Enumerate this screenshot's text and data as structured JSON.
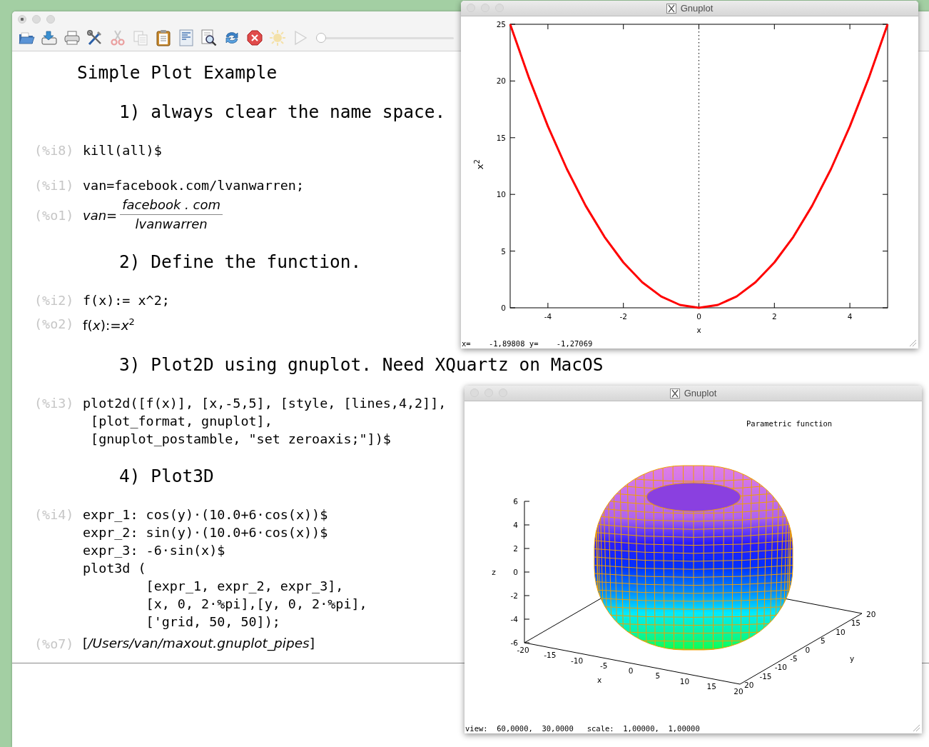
{
  "main_window": {
    "toolbar": {
      "buttons": [
        {
          "disabled": false
        },
        {
          "disabled": false
        },
        {
          "disabled": false
        },
        {
          "disabled": false
        },
        {
          "disabled": true
        },
        {
          "disabled": true
        },
        {
          "disabled": false
        },
        {
          "disabled": false
        },
        {
          "disabled": false
        },
        {
          "disabled": false
        },
        {
          "disabled": false
        },
        {
          "disabled": true
        },
        {
          "disabled": true
        }
      ],
      "slider": {
        "level": 0
      }
    },
    "cells": [
      {
        "kind": "title",
        "text": "Simple Plot Example"
      },
      {
        "kind": "heading",
        "text": "1) always clear the name space."
      },
      {
        "kind": "input",
        "label": "(%i8)",
        "lines": [
          "kill(all)$"
        ]
      },
      {
        "kind": "input",
        "label": "(%i1)",
        "lines": [
          "van=facebook.com/lvanwarren;"
        ]
      },
      {
        "kind": "fraction",
        "label": "(%o1)",
        "lhs": "van=",
        "numerator": "facebook . com",
        "denominator": "lvanwarren"
      },
      {
        "kind": "heading",
        "text": "2) Define the function."
      },
      {
        "kind": "input",
        "label": "(%i2)",
        "lines": [
          "f(x):= x^2;"
        ]
      },
      {
        "kind": "math",
        "label": "(%o2)",
        "text": "f(*x*):=*x*$^{2}$"
      },
      {
        "kind": "heading",
        "text": "3) Plot2D using gnuplot. Need XQuartz on MacOS"
      },
      {
        "kind": "input",
        "label": "(%i3)",
        "lines": [
          "plot2d([f(x)], [x,-5,5], [style, [lines,4,2]],",
          " [plot_format, gnuplot],",
          " [gnuplot_postamble, \"set zeroaxis;\"])$"
        ]
      },
      {
        "kind": "heading",
        "text": "4) Plot3D"
      },
      {
        "kind": "input",
        "label": "(%i4)",
        "lines": [
          "expr_1: cos(y)·(10.0+6·cos(x))$",
          "expr_2: sin(y)·(10.0+6·cos(x))$",
          "expr_3: -6·sin(x)$",
          "plot3d (",
          "        [expr_1, expr_2, expr_3],",
          "        [x, 0, 2·%pi],[y, 0, 2·%pi],",
          "        ['grid, 50, 50]);"
        ]
      },
      {
        "kind": "math",
        "label": "(%o7)",
        "text": "[*/Users/van/maxout.gnuplot_pipes*]"
      }
    ]
  },
  "plot_window": {
    "title": "Gnuplot",
    "status": "x=    -1,89808 y=    -1,27069",
    "chart_data": {
      "type": "line",
      "xlabel": "x",
      "ylabel": "x$^{2}$",
      "x": [
        -5,
        -4.5,
        -4,
        -3.5,
        -3,
        -2.5,
        -2,
        -1.5,
        -1,
        -0.5,
        0,
        0.5,
        1,
        1.5,
        2,
        2.5,
        3,
        3.5,
        4,
        4.5,
        5
      ],
      "series": [
        {
          "color": "#ff0000",
          "values": [
            25,
            20.25,
            16,
            12.25,
            9,
            6.25,
            4,
            2.25,
            1,
            0.25,
            0,
            0.25,
            1,
            2.25,
            4,
            6.25,
            9,
            12.25,
            16,
            20.25,
            25
          ]
        }
      ],
      "xlim": [
        -5,
        5
      ],
      "ylim": [
        0,
        25
      ],
      "xticks": [
        -4,
        -2,
        0,
        2,
        4
      ],
      "yticks": [
        0,
        5,
        10,
        15,
        20,
        25
      ]
    }
  },
  "plot3d_window": {
    "title": "Gnuplot",
    "plot_title": "Parametric function",
    "z_axis": {
      "label": "z",
      "ticks": [
        "6",
        "4",
        "2",
        "0",
        "-2",
        "-4",
        "-6"
      ]
    },
    "x_axis": {
      "label": "x",
      "ticks": [
        "-20",
        "-15",
        "-10",
        "-5",
        "0",
        "5",
        "10",
        "15",
        "20"
      ]
    },
    "y_axis": {
      "label": "y",
      "ticks": [
        "20",
        "-15",
        "-10",
        "-5",
        "0",
        "5",
        "10",
        "15",
        "20"
      ]
    },
    "status": "view:  60,0000,  30,0000   scale:  1,00000,  1,00000"
  }
}
